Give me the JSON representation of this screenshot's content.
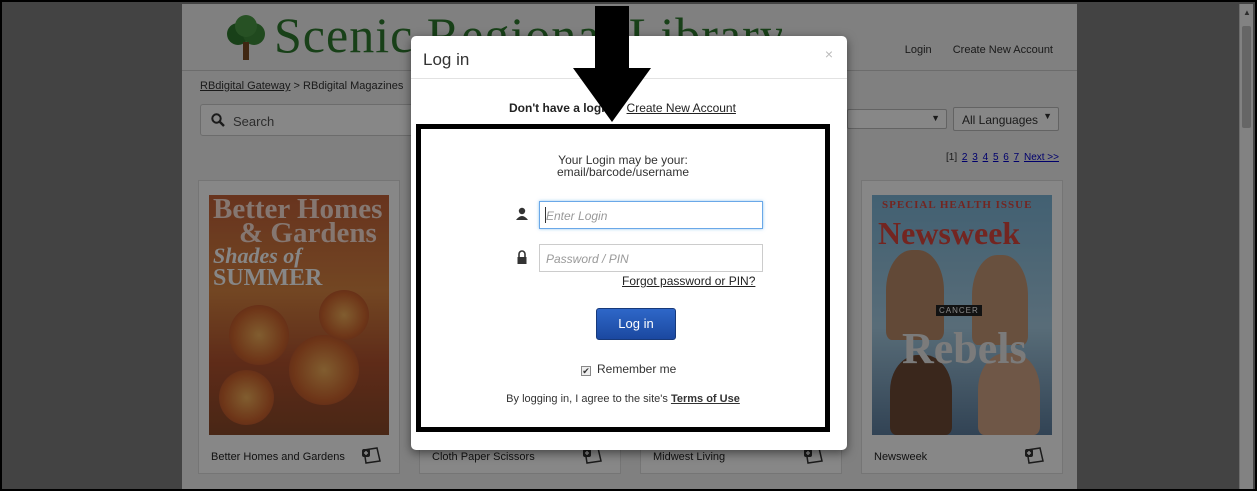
{
  "header": {
    "logo_text": "Scenic Regional Library",
    "login_link": "Login",
    "create_account_link": "Create New Account"
  },
  "breadcrumb": {
    "gateway": "RBdigital Gateway",
    "separator": " > ",
    "current": "RBdigital Magazines"
  },
  "search": {
    "placeholder": "Search",
    "icon": "search-icon"
  },
  "filters": {
    "language": "All Languages"
  },
  "pager": {
    "current": "[1]",
    "pages": [
      "2",
      "3",
      "4",
      "5",
      "6",
      "7"
    ],
    "next": "Next >>"
  },
  "magazines": [
    {
      "title": "Better Homes and Gardens",
      "cover_title": "Better Homes",
      "cover_sub": "& Gardens",
      "cover_tag1": "Shades of",
      "cover_tag2": "SUMMER"
    },
    {
      "title": "Cloth Paper Scissors"
    },
    {
      "title": "Midwest Living"
    },
    {
      "title": "Newsweek",
      "cover_title": "Newsweek",
      "cover_top": "SPECIAL HEALTH ISSUE",
      "cover_badge": "CANCER",
      "cover_big": "Rebels"
    }
  ],
  "modal": {
    "title": "Log in",
    "close": "×",
    "no_account_text": "Don't have a login?",
    "create_account": "Create New Account",
    "hint_line1": "Your Login may be your:",
    "hint_line2": "email/barcode/username",
    "login_placeholder": "Enter Login",
    "password_placeholder": "Password / PIN",
    "forgot": "Forgot password or PIN?",
    "login_button": "Log in",
    "remember_me": "Remember me",
    "remember_checked": true,
    "terms_prefix": "By logging in, I agree to the site's ",
    "terms_link": "Terms of Use"
  },
  "colors": {
    "logo_green": "#2f7a2f",
    "button_blue": "#1f55b5",
    "highlight_border": "#000000"
  }
}
